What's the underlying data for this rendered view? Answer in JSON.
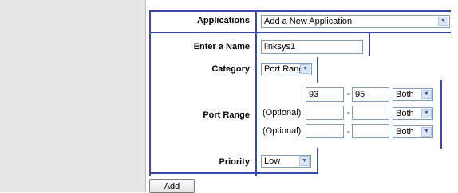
{
  "form": {
    "applications_label": "Applications",
    "applications_value": "Add a New Application",
    "name_label": "Enter a Name",
    "name_value": "linksys1",
    "category_label": "Category",
    "category_value": "Port Range",
    "port_range_label": "Port Range",
    "optional_label": "(Optional)",
    "dash": "-",
    "rows": [
      {
        "start": "93",
        "end": "95",
        "protocol": "Both"
      },
      {
        "start": "",
        "end": "",
        "protocol": "Both"
      },
      {
        "start": "",
        "end": "",
        "protocol": "Both"
      }
    ],
    "priority_label": "Priority",
    "priority_value": "Low",
    "add_label": "Add"
  },
  "icons": {
    "dropdown": "chevron-down-icon"
  },
  "colors": {
    "accent": "#3a4aa8"
  }
}
